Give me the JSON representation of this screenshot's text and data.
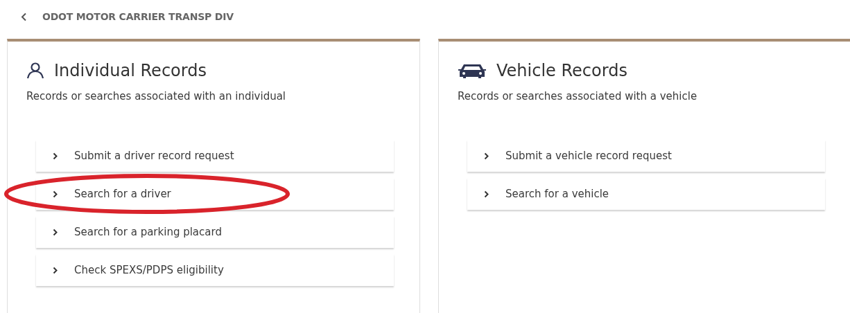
{
  "breadcrumb": {
    "label": "ODOT MOTOR CARRIER TRANSP DIV"
  },
  "cards": [
    {
      "kind": "person",
      "title": "Individual Records",
      "description": "Records or searches associated with an individual",
      "items": [
        {
          "label": "Submit a driver record request",
          "circled": false
        },
        {
          "label": "Search for a driver",
          "circled": true
        },
        {
          "label": "Search for a parking placard",
          "circled": false
        },
        {
          "label": "Check SPEXS/PDPS eligibility",
          "circled": false
        }
      ]
    },
    {
      "kind": "vehicle",
      "title": "Vehicle Records",
      "description": "Records or searches associated with a vehicle",
      "items": [
        {
          "label": "Submit a vehicle record request",
          "circled": false
        },
        {
          "label": "Search for a vehicle",
          "circled": false
        }
      ]
    }
  ]
}
